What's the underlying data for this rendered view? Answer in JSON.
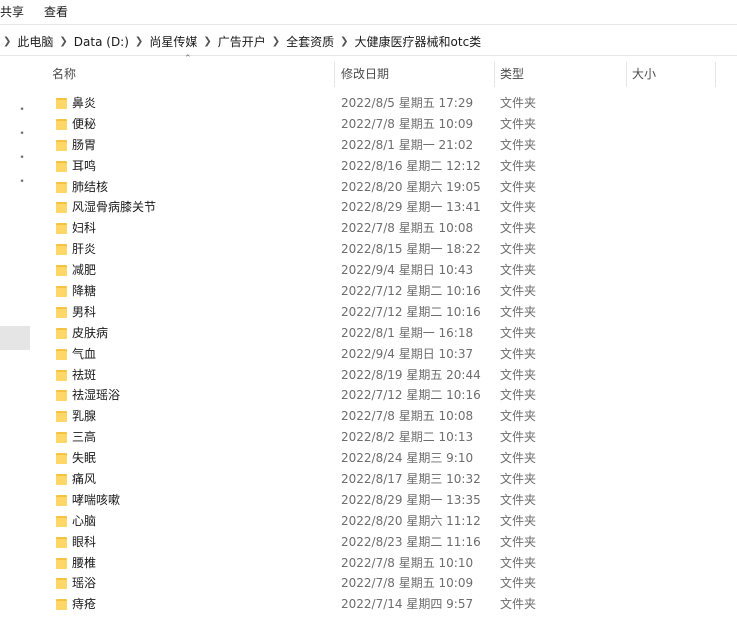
{
  "menu": {
    "share_label": "共享",
    "view_label": "查看"
  },
  "breadcrumb": [
    "此电脑",
    "Data (D:)",
    "尚星传媒",
    "广告开户",
    "全套资质",
    "大健康医疗器械和otc类"
  ],
  "columns": {
    "name": "名称",
    "date": "修改日期",
    "type": "类型",
    "size": "大小"
  },
  "files": [
    {
      "name": "鼻炎",
      "date": "2022/8/5 星期五 17:29",
      "type": "文件夹",
      "size": ""
    },
    {
      "name": "便秘",
      "date": "2022/7/8 星期五 10:09",
      "type": "文件夹",
      "size": ""
    },
    {
      "name": "肠胃",
      "date": "2022/8/1 星期一 21:02",
      "type": "文件夹",
      "size": ""
    },
    {
      "name": "耳鸣",
      "date": "2022/8/16 星期二 12:12",
      "type": "文件夹",
      "size": ""
    },
    {
      "name": "肺结核",
      "date": "2022/8/20 星期六 19:05",
      "type": "文件夹",
      "size": ""
    },
    {
      "name": "风湿骨病膝关节",
      "date": "2022/8/29 星期一 13:41",
      "type": "文件夹",
      "size": ""
    },
    {
      "name": "妇科",
      "date": "2022/7/8 星期五 10:08",
      "type": "文件夹",
      "size": ""
    },
    {
      "name": "肝炎",
      "date": "2022/8/15 星期一 18:22",
      "type": "文件夹",
      "size": ""
    },
    {
      "name": "减肥",
      "date": "2022/9/4 星期日 10:43",
      "type": "文件夹",
      "size": ""
    },
    {
      "name": "降糖",
      "date": "2022/7/12 星期二 10:16",
      "type": "文件夹",
      "size": ""
    },
    {
      "name": "男科",
      "date": "2022/7/12 星期二 10:16",
      "type": "文件夹",
      "size": ""
    },
    {
      "name": "皮肤病",
      "date": "2022/8/1 星期一 16:18",
      "type": "文件夹",
      "size": ""
    },
    {
      "name": "气血",
      "date": "2022/9/4 星期日 10:37",
      "type": "文件夹",
      "size": ""
    },
    {
      "name": "祛斑",
      "date": "2022/8/19 星期五 20:44",
      "type": "文件夹",
      "size": ""
    },
    {
      "name": "祛湿瑶浴",
      "date": "2022/7/12 星期二 10:16",
      "type": "文件夹",
      "size": ""
    },
    {
      "name": "乳腺",
      "date": "2022/7/8 星期五 10:08",
      "type": "文件夹",
      "size": ""
    },
    {
      "name": "三高",
      "date": "2022/8/2 星期二 10:13",
      "type": "文件夹",
      "size": ""
    },
    {
      "name": "失眠",
      "date": "2022/8/24 星期三 9:10",
      "type": "文件夹",
      "size": ""
    },
    {
      "name": "痛风",
      "date": "2022/8/17 星期三 10:32",
      "type": "文件夹",
      "size": ""
    },
    {
      "name": "哮喘咳嗽",
      "date": "2022/8/29 星期一 13:35",
      "type": "文件夹",
      "size": ""
    },
    {
      "name": "心脑",
      "date": "2022/8/20 星期六 11:12",
      "type": "文件夹",
      "size": ""
    },
    {
      "name": "眼科",
      "date": "2022/8/23 星期二 11:16",
      "type": "文件夹",
      "size": ""
    },
    {
      "name": "腰椎",
      "date": "2022/7/8 星期五 10:10",
      "type": "文件夹",
      "size": ""
    },
    {
      "name": "瑶浴",
      "date": "2022/7/8 星期五 10:09",
      "type": "文件夹",
      "size": ""
    },
    {
      "name": "痔疮",
      "date": "2022/7/14 星期四 9:57",
      "type": "文件夹",
      "size": ""
    }
  ],
  "colors": {
    "folder_back": "#f5c242",
    "folder_front": "#ffd766",
    "secondary_text": "#6d6d6d",
    "nav_selected": "#e5e5e5"
  }
}
